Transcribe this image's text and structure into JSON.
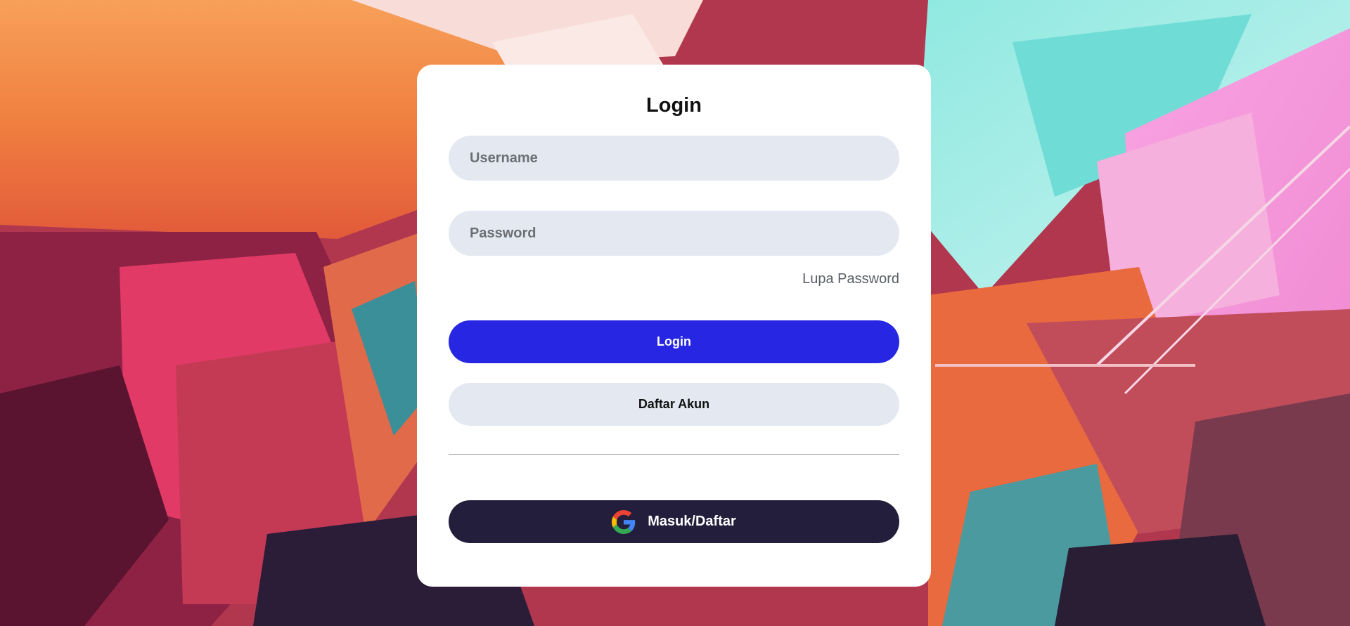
{
  "login": {
    "title": "Login",
    "username_placeholder": "Username",
    "password_placeholder": "Password",
    "forgot_password_label": "Lupa Password",
    "login_button_label": "Login",
    "register_button_label": "Daftar Akun",
    "google_button_label": "Masuk/Daftar"
  },
  "colors": {
    "primary_button": "#2727e3",
    "secondary_button": "#e3e8f1",
    "google_button": "#221e3c",
    "card_background": "#ffffff"
  },
  "icons": {
    "google": "google-g-icon"
  }
}
